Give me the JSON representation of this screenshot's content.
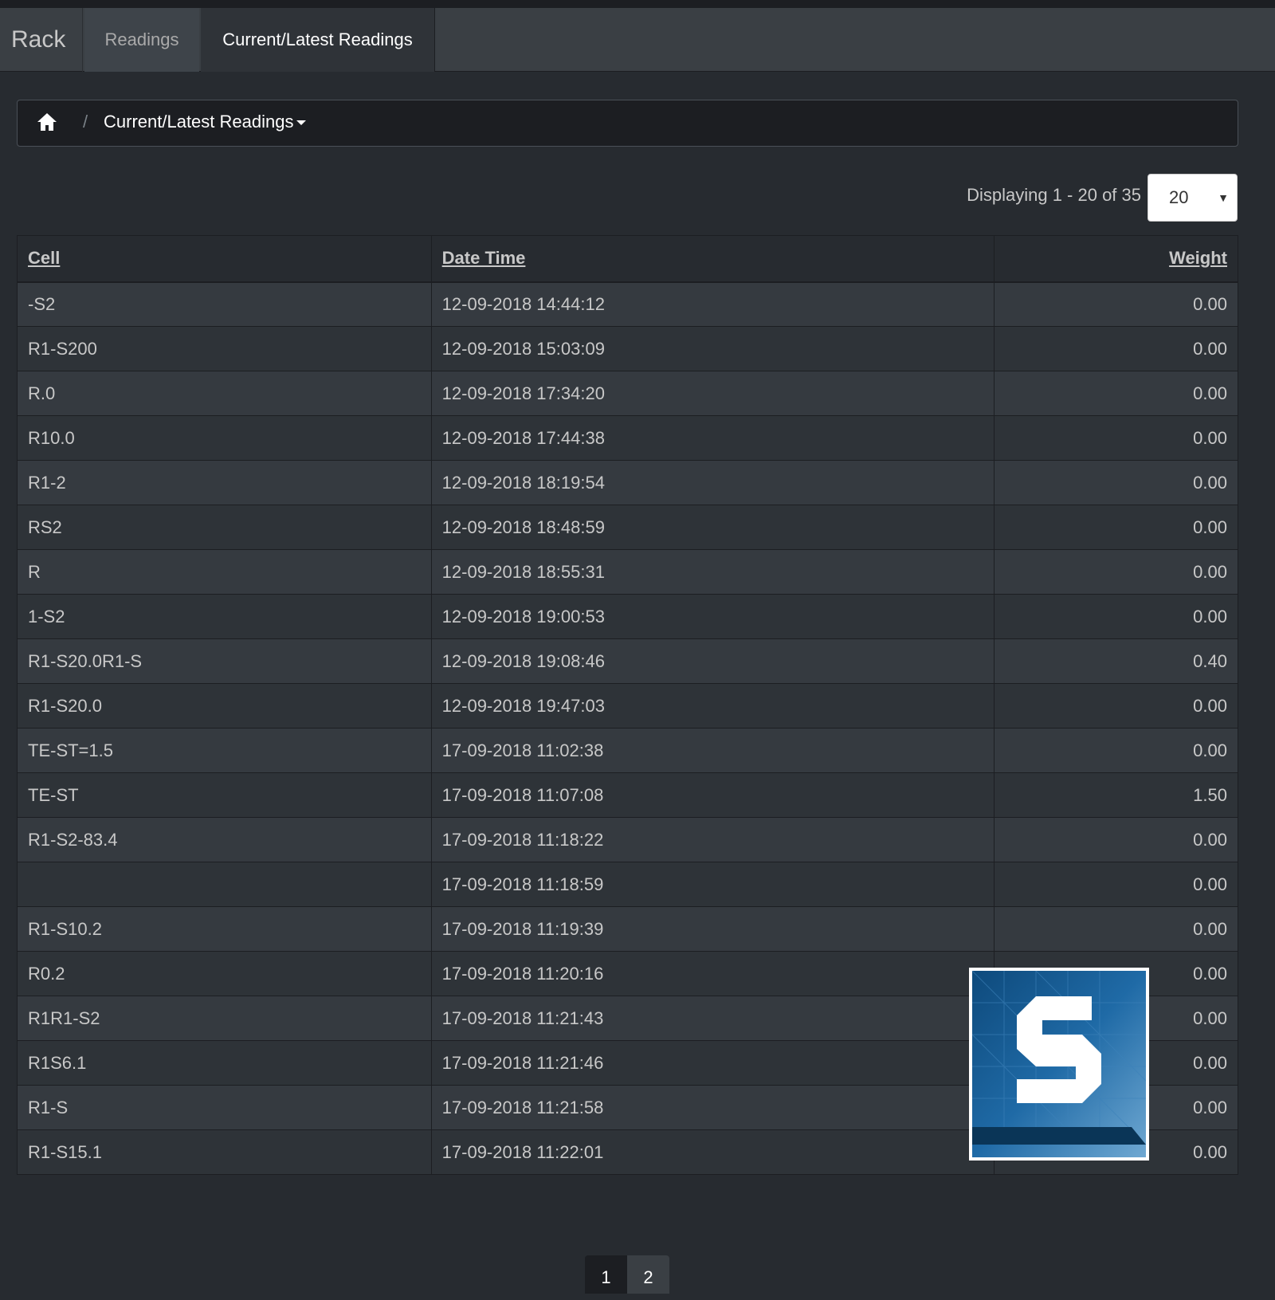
{
  "navbar": {
    "brand": "Rack",
    "tabs": [
      {
        "label": "Readings"
      },
      {
        "label": "Current/Latest Readings"
      }
    ]
  },
  "breadcrumb": {
    "separator": "/",
    "current": "Current/Latest Readings"
  },
  "pager_info": {
    "text": "Displaying 1 - 20 of 35",
    "page_size": "20"
  },
  "table": {
    "headers": [
      "Cell",
      "Date Time",
      "Weight"
    ],
    "rows": [
      [
        "-S2",
        "12-09-2018 14:44:12",
        "0.00"
      ],
      [
        "R1-S200",
        "12-09-2018 15:03:09",
        "0.00"
      ],
      [
        "R.0",
        "12-09-2018 17:34:20",
        "0.00"
      ],
      [
        "R10.0",
        "12-09-2018 17:44:38",
        "0.00"
      ],
      [
        "R1-2",
        "12-09-2018 18:19:54",
        "0.00"
      ],
      [
        "RS2",
        "12-09-2018 18:48:59",
        "0.00"
      ],
      [
        "R",
        "12-09-2018 18:55:31",
        "0.00"
      ],
      [
        "1-S2",
        "12-09-2018 19:00:53",
        "0.00"
      ],
      [
        "R1-S20.0R1-S",
        "12-09-2018 19:08:46",
        "0.40"
      ],
      [
        "R1-S20.0",
        "12-09-2018 19:47:03",
        "0.00"
      ],
      [
        "TE-ST=1.5",
        "17-09-2018 11:02:38",
        "0.00"
      ],
      [
        "TE-ST",
        "17-09-2018 11:07:08",
        "1.50"
      ],
      [
        "R1-S2-83.4",
        "17-09-2018 11:18:22",
        "0.00"
      ],
      [
        "",
        "17-09-2018 11:18:59",
        "0.00"
      ],
      [
        "R1-S10.2",
        "17-09-2018 11:19:39",
        "0.00"
      ],
      [
        "R0.2",
        "17-09-2018 11:20:16",
        "0.00"
      ],
      [
        "R1R1-S2",
        "17-09-2018 11:21:43",
        "0.00"
      ],
      [
        "R1S6.1",
        "17-09-2018 11:21:46",
        "0.00"
      ],
      [
        "R1-S",
        "17-09-2018 11:21:58",
        "0.00"
      ],
      [
        "R1-S15.1",
        "17-09-2018 11:22:01",
        "0.00"
      ]
    ]
  },
  "pagination": {
    "pages": [
      "1",
      "2"
    ],
    "active": "1"
  },
  "colors": {
    "background": "#272b30",
    "navbar": "#3a3f44",
    "row_odd": "#353a40",
    "row_even": "#2e3338",
    "logo_blue": "#1b5e94"
  },
  "icons": {
    "home": "home-icon",
    "overlay": "snagit-logo-icon"
  }
}
